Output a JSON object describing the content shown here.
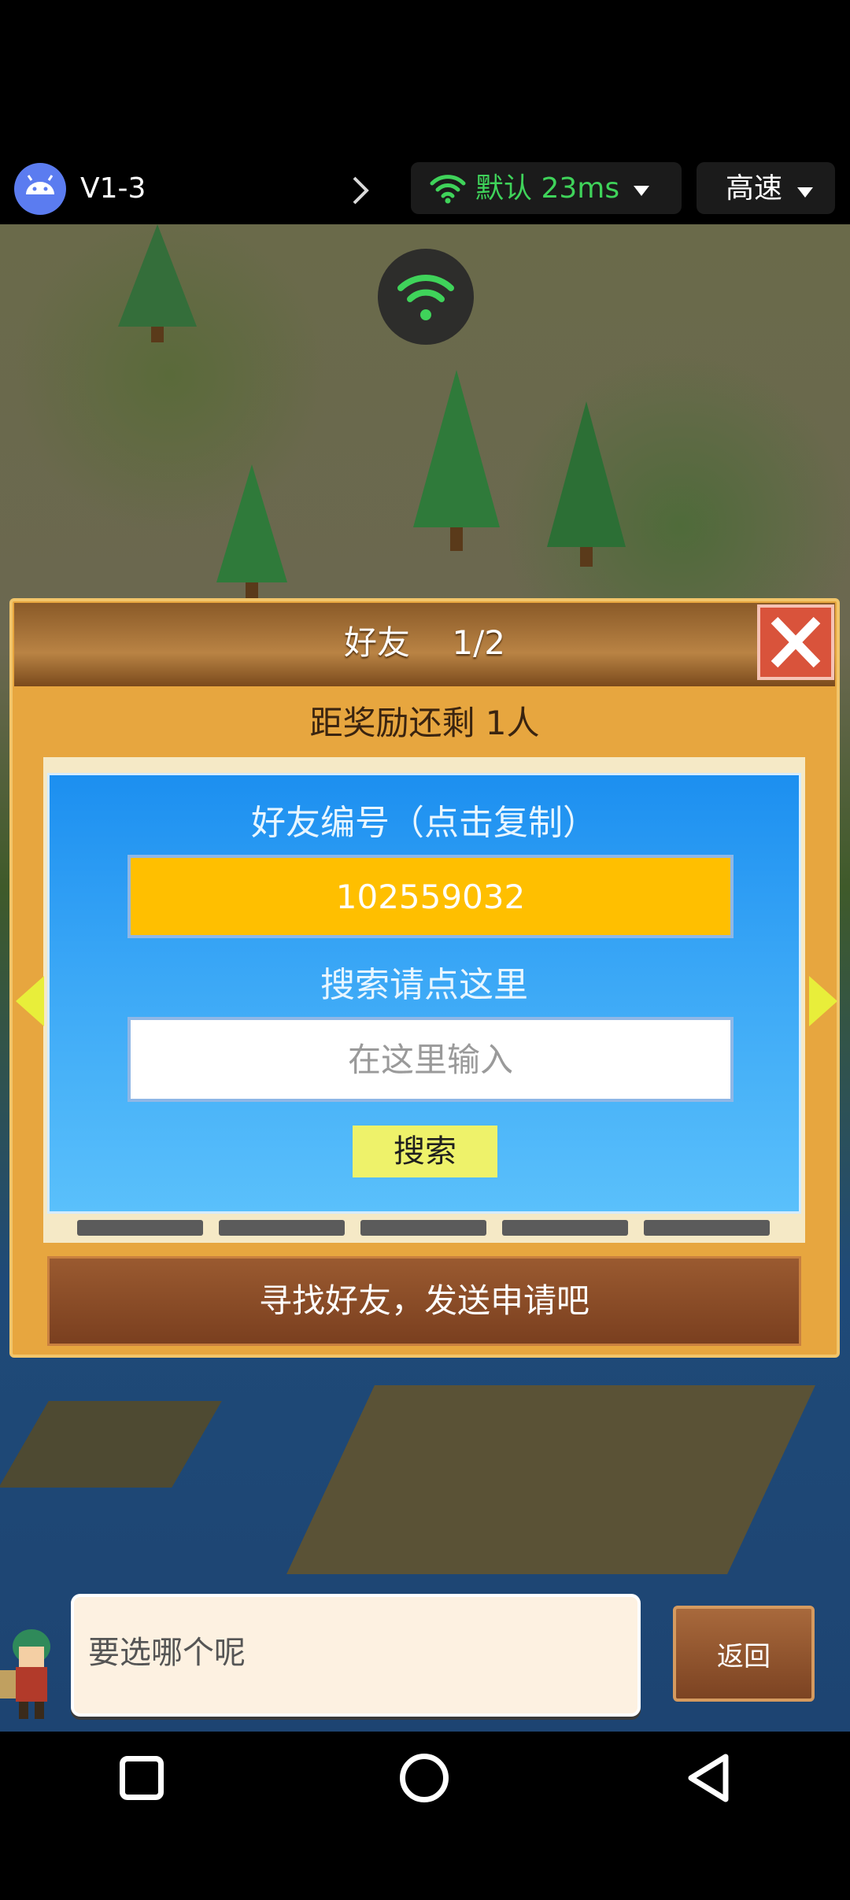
{
  "status_bar": {
    "app_icon": "android-robot-icon",
    "version": "V1-3",
    "network_icon": "wifi-icon",
    "network_label": "默认 23ms",
    "speed_label": "高速"
  },
  "dialog": {
    "title": "好友    1/2",
    "close_icon": "close-x-icon",
    "reward_text": "距奖励还剩 1人",
    "friend_id_label": "好友编号（点击复制）",
    "friend_id_value": "102559032",
    "search_hint": "搜索请点这里",
    "search_placeholder": "在这里输入",
    "search_button": "搜索",
    "apply_button": "寻找好友，发送申请吧"
  },
  "speech": {
    "text": "要选哪个呢",
    "back_button": "返回"
  },
  "colors": {
    "network_green": "#3fd35a",
    "friend_id_bg": "#ffbf00",
    "search_button_bg": "#eef26a",
    "panel_blue": "#3aa7f6",
    "dialog_orange": "#e7a63f"
  }
}
